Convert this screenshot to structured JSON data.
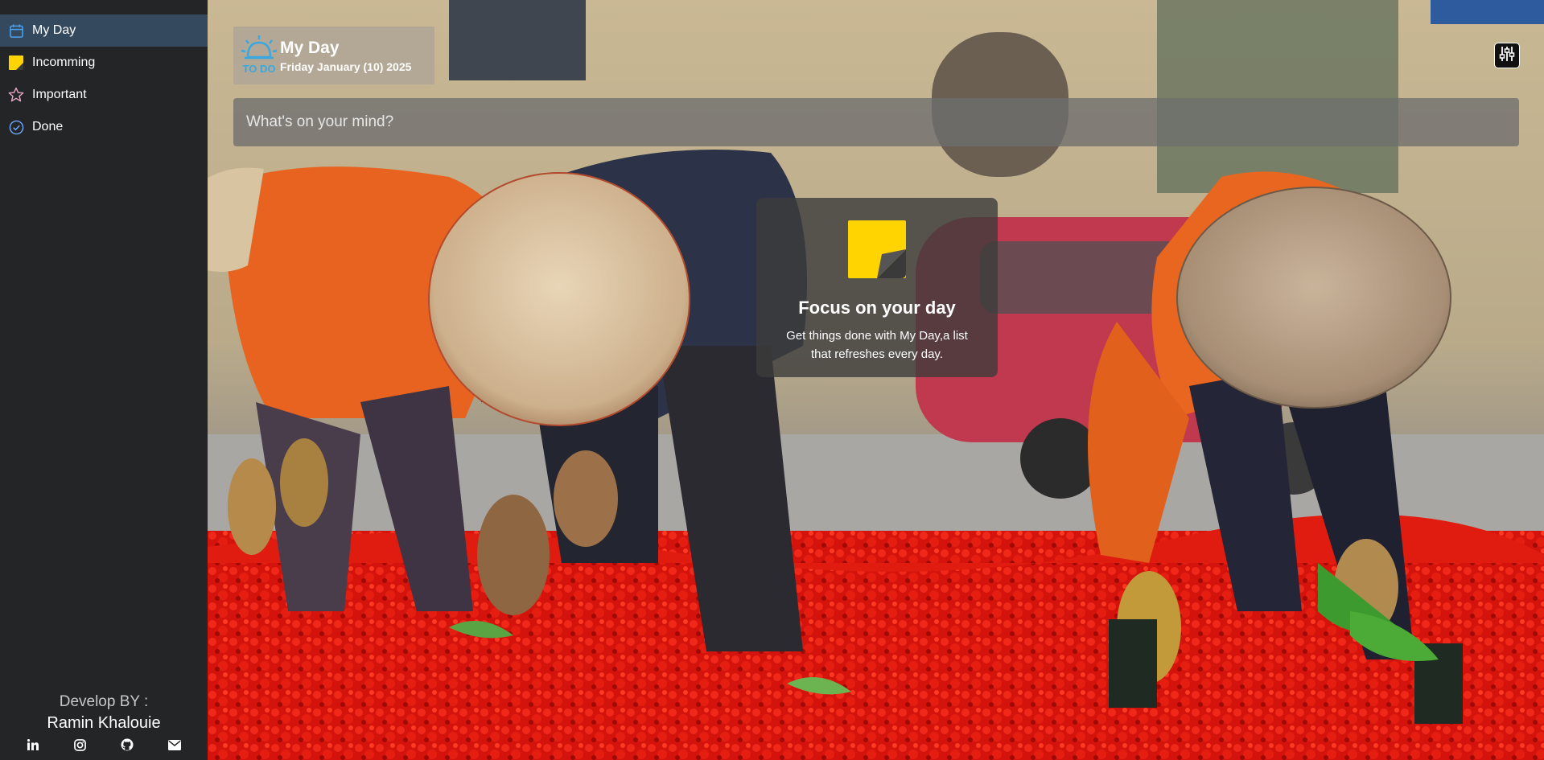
{
  "sidebar": {
    "items": [
      {
        "label": "My Day",
        "icon": "calendar-icon",
        "active": true
      },
      {
        "label": "Incomming",
        "icon": "sticky-note-icon",
        "active": false
      },
      {
        "label": "Important",
        "icon": "star-icon",
        "active": false
      },
      {
        "label": "Done",
        "icon": "check-circle-icon",
        "active": false
      }
    ],
    "footer": {
      "dev_label": "Develop BY :",
      "dev_name": "Ramin Khalouie",
      "socials": [
        "linkedin-icon",
        "instagram-icon",
        "github-icon",
        "email-icon"
      ]
    }
  },
  "header": {
    "logo_text": "TO DO",
    "title": "My Day",
    "date": "Friday January (10) 2025"
  },
  "task_input": {
    "placeholder": "What's on your mind?"
  },
  "focus_card": {
    "title": "Focus on your day",
    "description": "Get things done with My Day,a list that refreshes every day."
  },
  "colors": {
    "sidebar_bg": "#242527",
    "active_item_bg": "#34495e",
    "note_yellow": "#ffd400",
    "logo_blue": "#3aa8e0"
  }
}
